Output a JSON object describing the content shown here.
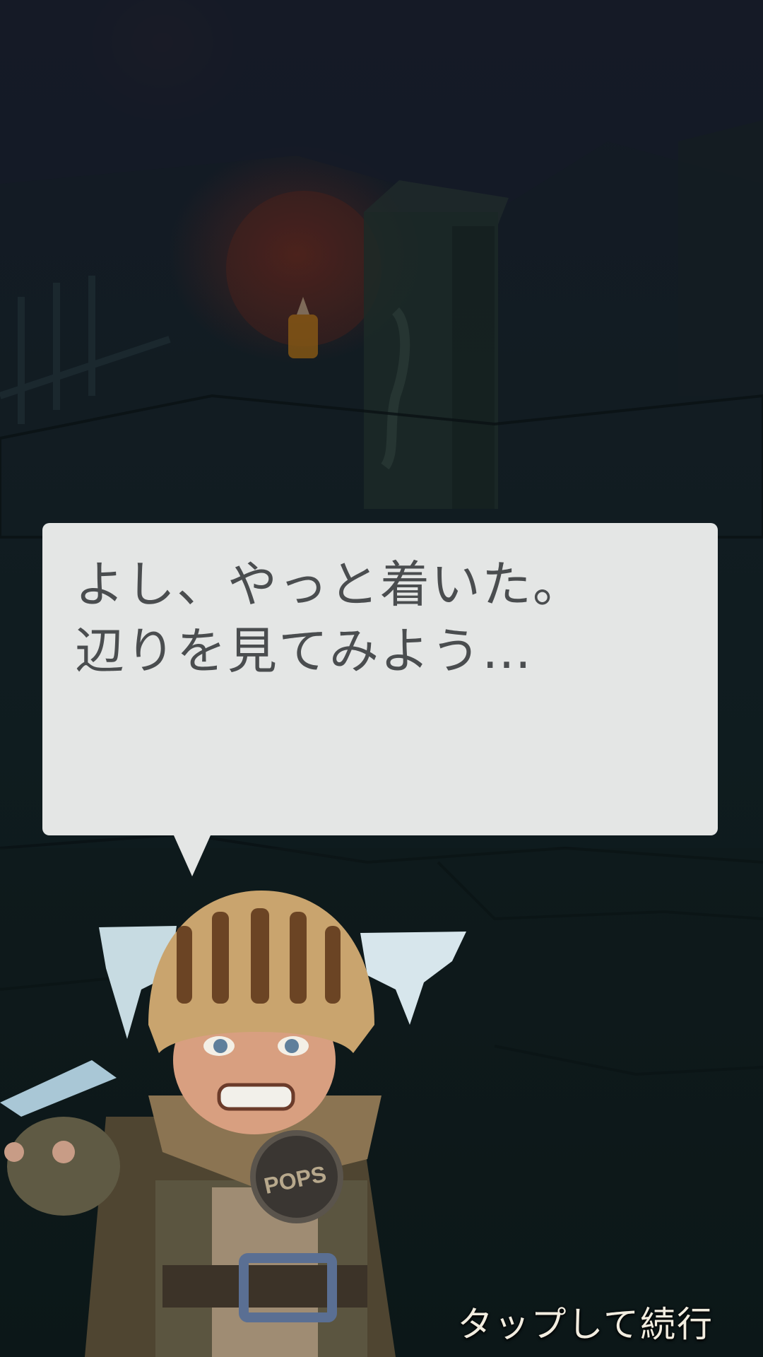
{
  "dialog": {
    "lines": [
      "よし、やっと着いた。",
      "辺りを見てみよう…"
    ]
  },
  "character": {
    "badge_text": "POPS"
  },
  "prompt": {
    "continue_label": "タップして続行"
  },
  "colors": {
    "dialog_bg": "#e4e6e5",
    "dialog_text": "#4a4d4f",
    "prompt_text": "#f2ede0",
    "helmet": "#c9a46e"
  }
}
